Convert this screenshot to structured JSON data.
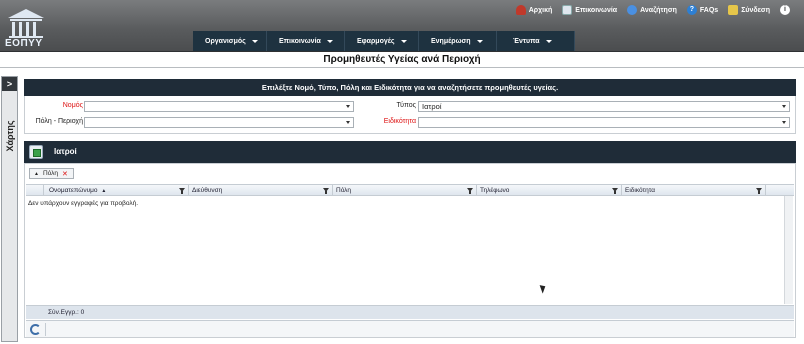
{
  "header": {
    "logo_text": "ΕΟΠΥΥ",
    "top_links": [
      {
        "label": "Αρχική",
        "icon": "home-icon"
      },
      {
        "label": "Επικοινωνία",
        "icon": "contact-icon"
      },
      {
        "label": "Αναζήτηση",
        "icon": "search-icon"
      },
      {
        "label": "FAQs",
        "icon": "faq-icon"
      },
      {
        "label": "Σύνδεση",
        "icon": "login-icon"
      }
    ],
    "info_glyph": "i",
    "nav": [
      {
        "label": "Οργανισμός"
      },
      {
        "label": "Επικοινωνία"
      },
      {
        "label": "Εφαρμογές"
      },
      {
        "label": "Ενημέρωση"
      },
      {
        "label": "Έντυπα"
      }
    ]
  },
  "page": {
    "title": "Προμηθευτές Υγείας ανά Περιοχή"
  },
  "side_tab": {
    "label": "Χάρτης",
    "toggle": ">"
  },
  "filters": {
    "instruction": "Επιλέξτε Νομό, Τύπο, Πόλη και Ειδικότητα για να αναζητήσετε προμηθευτές υγείας.",
    "nomos_label": "Νομός",
    "nomos_value": "",
    "typos_label": "Τύπος",
    "typos_value": "Ιατροί",
    "poli_label": "Πόλη - Περιοχή",
    "poli_value": "",
    "eidikotita_label": "Ειδικότητα",
    "eidikotita_value": ""
  },
  "results": {
    "title": "Ιατροί",
    "group_chip": "Πόλη",
    "columns": [
      "Ονοματεπώνυμο",
      "Διεύθυνση",
      "Πόλη",
      "Τηλέφωνο",
      "Ειδικότητα"
    ],
    "empty_message": "Δεν υπάρχουν εγγραφές για προβολή.",
    "total_label": "Σύν.Εγγρ.: 0"
  },
  "colors": {
    "header_bg": "#5a5c5e",
    "nav_bg": "#1e3240",
    "panel_header_bg": "#1f2c38",
    "required_label": "#dd1111"
  }
}
